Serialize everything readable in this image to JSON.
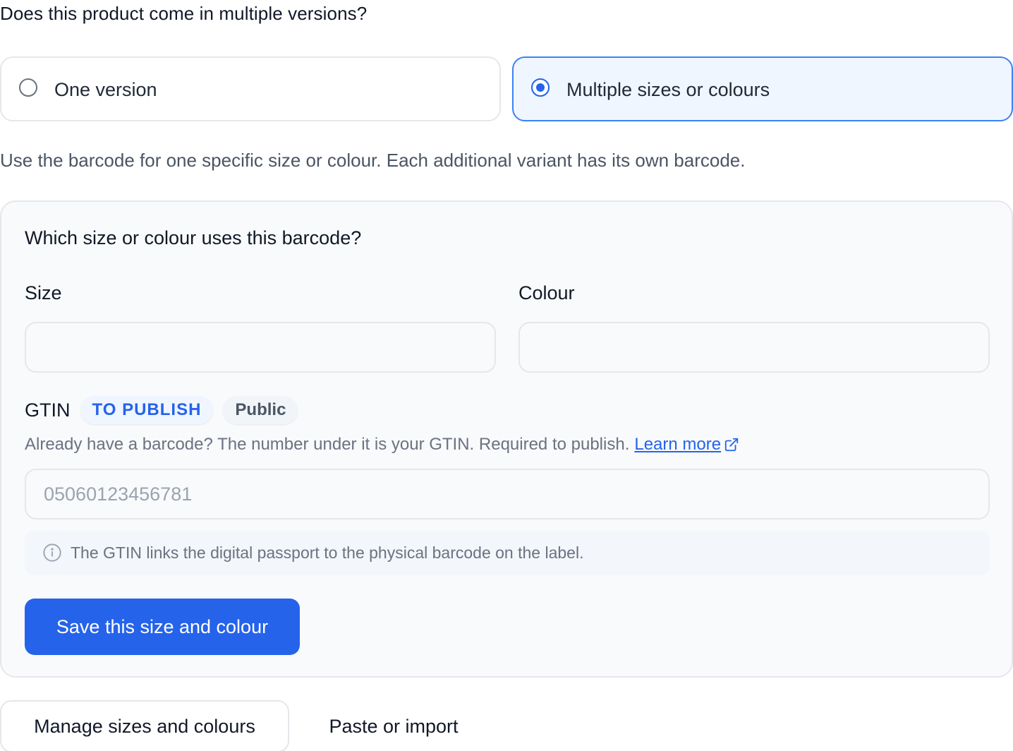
{
  "question": "Does this product come in multiple versions?",
  "options": [
    {
      "label": "One version",
      "selected": false
    },
    {
      "label": "Multiple sizes or colours",
      "selected": true
    }
  ],
  "hint": "Use the barcode for one specific size or colour. Each additional variant has its own barcode.",
  "variant_panel": {
    "title": "Which size or colour uses this barcode?",
    "size": {
      "label": "Size",
      "value": ""
    },
    "colour": {
      "label": "Colour",
      "value": ""
    },
    "gtin": {
      "label": "GTIN",
      "badges": [
        "TO PUBLISH",
        "Public"
      ],
      "help_text": "Already have a barcode? The number under it is your GTIN. Required to publish.",
      "learn_more": "Learn more",
      "placeholder": "05060123456781",
      "value": ""
    },
    "note": "The GTIN links the digital passport to the physical barcode on the label.",
    "save_label": "Save this size and colour"
  },
  "footer": {
    "manage_label": "Manage sizes and colours",
    "import_label": "Paste or import"
  },
  "colors": {
    "accent": "#2563eb",
    "selected_bg": "#eff6ff",
    "panel_bg": "#f8fafc"
  }
}
